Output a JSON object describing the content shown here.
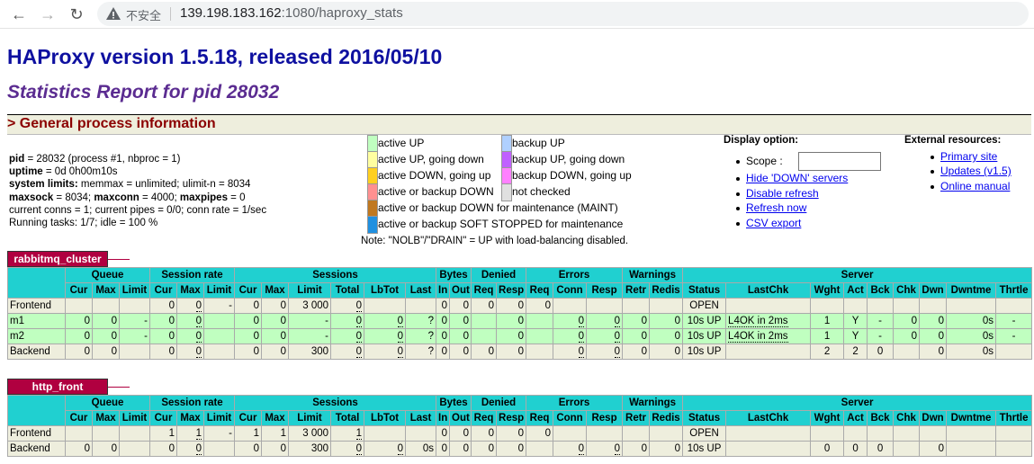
{
  "browser": {
    "insecure_label": "不安全",
    "url_host": "139.198.183.162",
    "url_rest": ":1080/haproxy_stats"
  },
  "page": {
    "title": "HAProxy version 1.5.18, released 2016/05/10",
    "subtitle": "Statistics Report for pid 28032",
    "section_title": "> General process information"
  },
  "process": {
    "pid_label": "pid",
    "pid_value": " = 28032 (process #1, nbproc = 1)",
    "uptime_label": "uptime",
    "uptime_value": " = 0d 0h00m10s",
    "limits_label": "system limits:",
    "limits_value": " memmax = unlimited; ulimit-n = 8034",
    "maxsock_label": "maxsock",
    "maxsock_value": " = 8034; ",
    "maxconn_label": "maxconn",
    "maxconn_value": " = 4000; ",
    "maxpipes_label": "maxpipes",
    "maxpipes_value": " = 0",
    "conns_line": "current conns = 1; current pipes = 0/0; conn rate = 1/sec",
    "tasks_line": "Running tasks: 1/7; idle = 100 %"
  },
  "legend_left": [
    {
      "color": "#c0ffc0",
      "label": "active UP"
    },
    {
      "color": "#ffffa0",
      "label": "active UP, going down"
    },
    {
      "color": "#ffd020",
      "label": "active DOWN, going up"
    },
    {
      "color": "#ff9090",
      "label": "active or backup DOWN"
    },
    {
      "color": "#c07820",
      "label": "active or backup DOWN for maintenance (MAINT)"
    },
    {
      "color": "#2090e0",
      "label": "active or backup SOFT STOPPED for maintenance"
    }
  ],
  "legend_right": [
    {
      "color": "#b0d0ff",
      "label": "backup UP"
    },
    {
      "color": "#c060ff",
      "label": "backup UP, going down"
    },
    {
      "color": "#ff80ff",
      "label": "backup DOWN, going up"
    },
    {
      "color": "#e0e0e0",
      "label": "not checked"
    }
  ],
  "legend_note": "Note: \"NOLB\"/\"DRAIN\" = UP with load-balancing disabled.",
  "display": {
    "title": "Display option:",
    "scope_label": "Scope :",
    "scope_value": "",
    "links": [
      "Hide 'DOWN' servers",
      "Disable refresh",
      "Refresh now",
      "CSV export"
    ]
  },
  "external": {
    "title": "External resources:",
    "links": [
      "Primary site",
      "Updates (v1.5)",
      "Online manual"
    ]
  },
  "table_headers": {
    "groups": [
      "Queue",
      "Session rate",
      "Sessions",
      "Bytes",
      "Denied",
      "Errors",
      "Warnings",
      "Server"
    ],
    "cols": [
      "Cur",
      "Max",
      "Limit",
      "Cur",
      "Max",
      "Limit",
      "Cur",
      "Max",
      "Limit",
      "Total",
      "LbTot",
      "Last",
      "In",
      "Out",
      "Req",
      "Resp",
      "Req",
      "Conn",
      "Resp",
      "Retr",
      "Redis",
      "Status",
      "LastChk",
      "Wght",
      "Act",
      "Bck",
      "Chk",
      "Dwn",
      "Dwntme",
      "Thrtle"
    ]
  },
  "proxies": [
    {
      "name": "rabbitmq_cluster",
      "rows": [
        {
          "type": "fe",
          "cells": [
            "Frontend",
            "",
            "",
            "",
            "0",
            "0",
            "-",
            "0",
            "0",
            "3 000",
            "0",
            "",
            "",
            "0",
            "0",
            "0",
            "0",
            "0",
            "",
            "",
            "",
            "",
            "OPEN",
            "",
            "",
            "",
            "",
            "",
            "",
            "",
            ""
          ]
        },
        {
          "type": "sv",
          "cells": [
            "m1",
            "0",
            "0",
            "-",
            "0",
            "0",
            "",
            "0",
            "0",
            "-",
            "0",
            "0",
            "?",
            "0",
            "0",
            "",
            "0",
            "",
            "0",
            "0",
            "0",
            "0",
            "10s UP",
            "L4OK in 2ms",
            "1",
            "Y",
            "-",
            "0",
            "0",
            "0s",
            "-"
          ]
        },
        {
          "type": "sv",
          "cells": [
            "m2",
            "0",
            "0",
            "-",
            "0",
            "0",
            "",
            "0",
            "0",
            "-",
            "0",
            "0",
            "?",
            "0",
            "0",
            "",
            "0",
            "",
            "0",
            "0",
            "0",
            "0",
            "10s UP",
            "L4OK in 2ms",
            "1",
            "Y",
            "-",
            "0",
            "0",
            "0s",
            "-"
          ]
        },
        {
          "type": "be",
          "cells": [
            "Backend",
            "0",
            "0",
            "",
            "0",
            "0",
            "",
            "0",
            "0",
            "300",
            "0",
            "0",
            "?",
            "0",
            "0",
            "0",
            "0",
            "",
            "0",
            "0",
            "0",
            "0",
            "10s UP",
            "",
            "2",
            "2",
            "0",
            "",
            "0",
            "0s",
            ""
          ]
        }
      ]
    },
    {
      "name": "http_front",
      "rows": [
        {
          "type": "fe",
          "cells": [
            "Frontend",
            "",
            "",
            "",
            "1",
            "1",
            "-",
            "1",
            "1",
            "3 000",
            "1",
            "",
            "",
            "0",
            "0",
            "0",
            "0",
            "0",
            "",
            "",
            "",
            "",
            "OPEN",
            "",
            "",
            "",
            "",
            "",
            "",
            "",
            ""
          ]
        },
        {
          "type": "be",
          "cells": [
            "Backend",
            "0",
            "0",
            "",
            "0",
            "0",
            "",
            "0",
            "0",
            "300",
            "0",
            "0",
            "0s",
            "0",
            "0",
            "0",
            "0",
            "",
            "0",
            "0",
            "0",
            "0",
            "10s UP",
            "",
            "0",
            "0",
            "0",
            "",
            "0",
            "",
            ""
          ]
        }
      ]
    }
  ]
}
